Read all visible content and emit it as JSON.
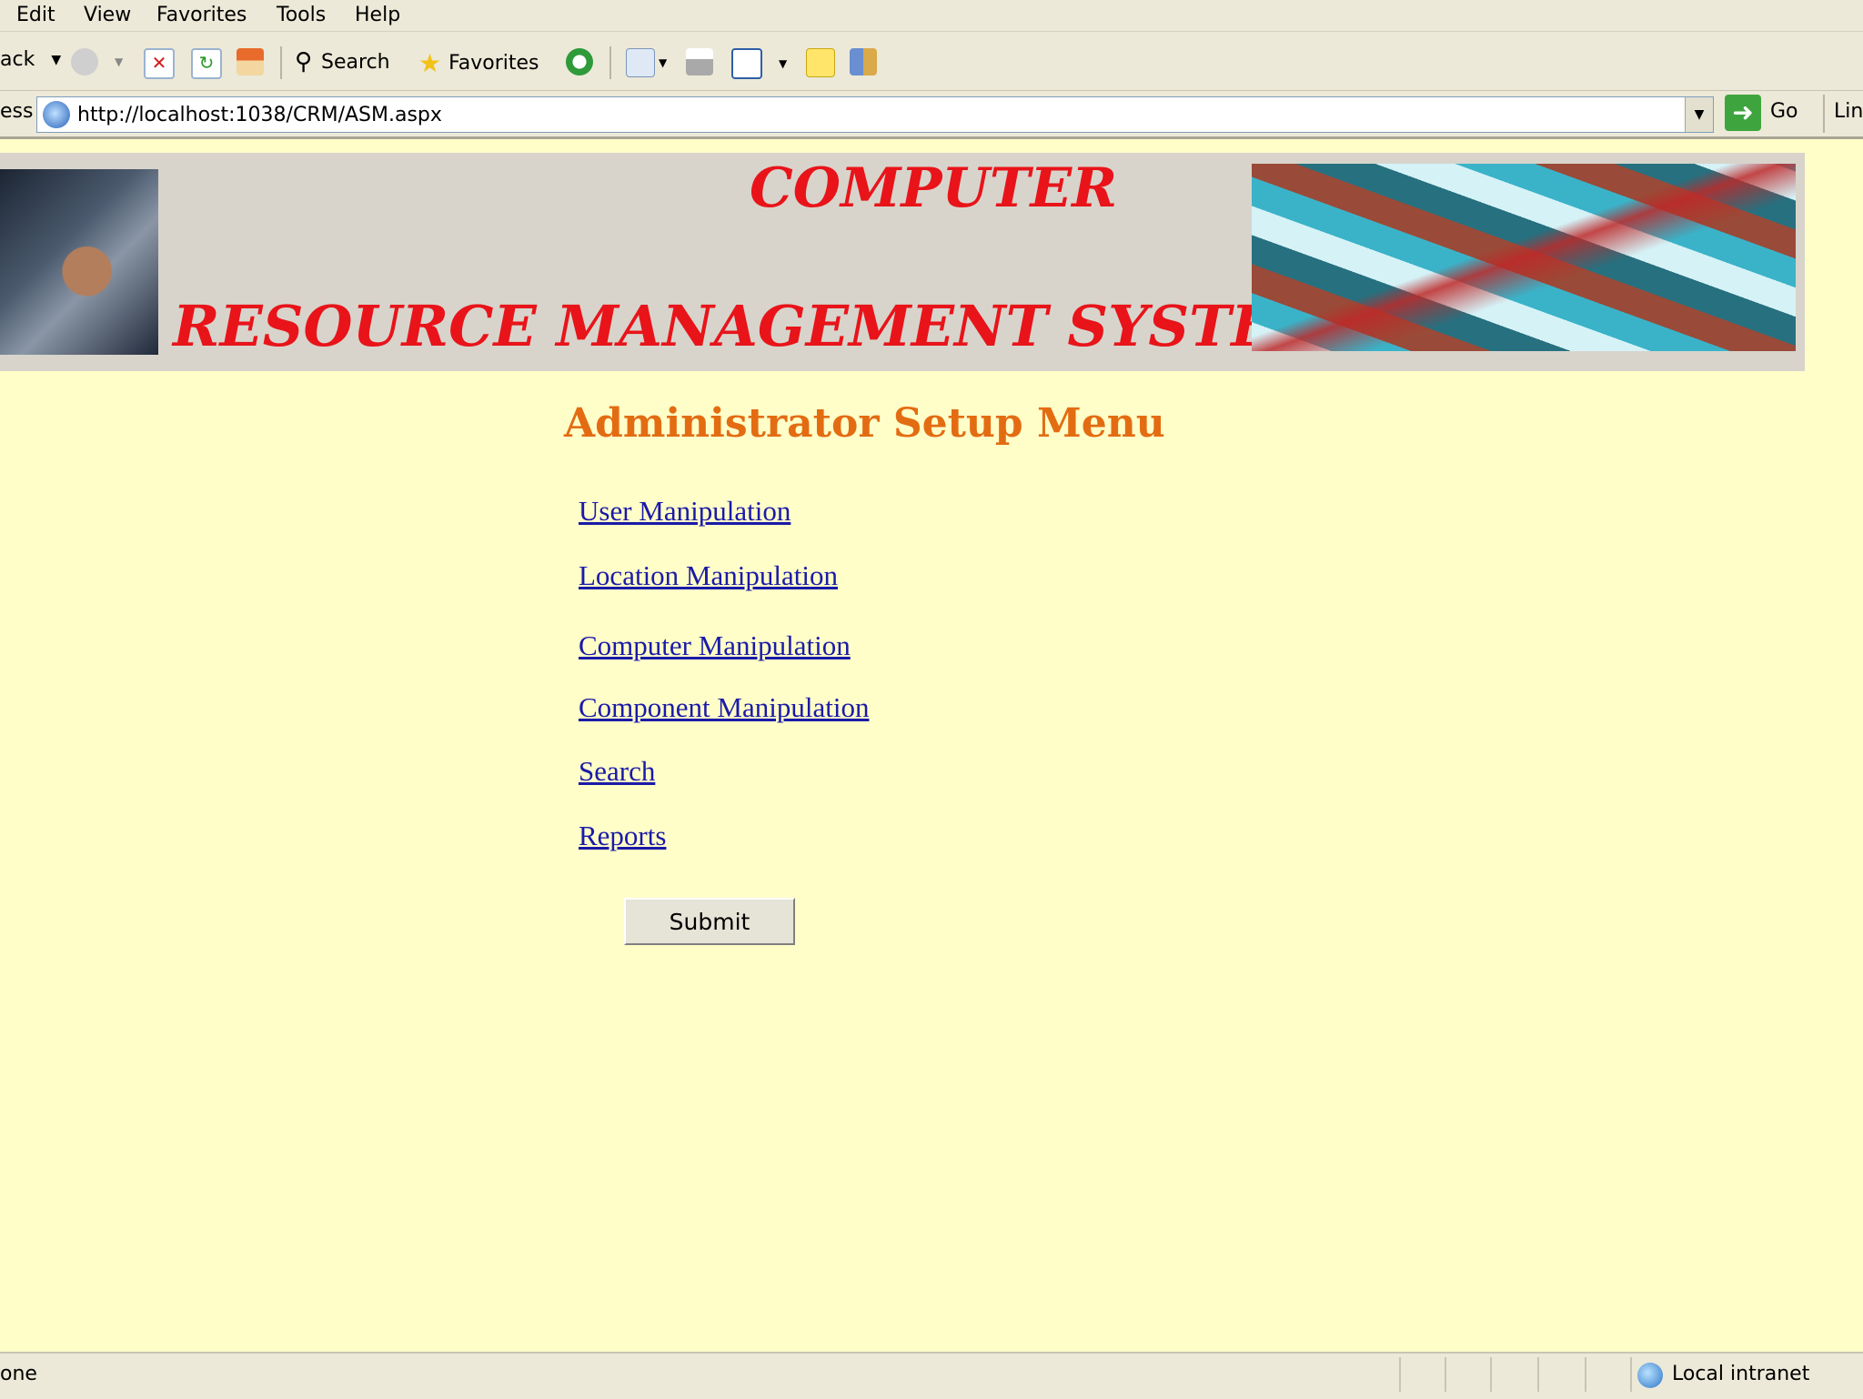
{
  "browser": {
    "menu": [
      "Edit",
      "View",
      "Favorites",
      "Tools",
      "Help"
    ],
    "toolbar": {
      "back_label": "ack",
      "search_label": "Search",
      "favorites_label": "Favorites"
    },
    "address": {
      "label": "ess",
      "url": "http://localhost:1038/CRM/ASM.aspx",
      "go_label": "Go",
      "links_label": "Lin"
    },
    "status": {
      "text": "one",
      "zone": "Local intranet"
    }
  },
  "page": {
    "banner": {
      "title_line1": "COMPUTER",
      "title_line2": "RESOURCE MANAGEMENT SYSTEM"
    },
    "heading": "Administrator Setup Menu",
    "links": [
      "User Manipulation",
      "Location Manipulation",
      "Computer Manipulation",
      "Component Manipulation",
      "Search",
      "Reports"
    ],
    "submit_label": "Submit"
  },
  "colors": {
    "page_background": "#fffdc8",
    "banner_title": "#e8141a",
    "heading": "#e36c12",
    "link": "#1a1aa8"
  }
}
